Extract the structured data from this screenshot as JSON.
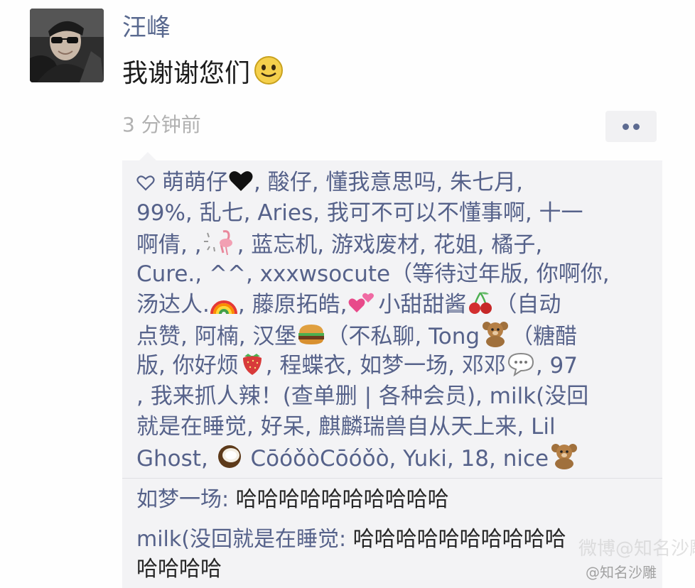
{
  "post": {
    "author": "汪峰",
    "text": "我谢谢您们",
    "timestamp": "3 分钟前",
    "emoji": "smile-emoji"
  },
  "likes": {
    "icon": "heart-outline-icon",
    "line1": {
      "a": "萌萌仔",
      "b": ", 酸仔, 懂我意思吗, 朱七月,"
    },
    "line2": "99%, 乱七, Aries, 我可不可以不懂事啊, 十一",
    "line3": {
      "a": "啊倩, ,",
      "b": ", 蓝忘机, 游戏废材, 花姐, 橘子,"
    },
    "line4": "Cure., ^^, xxxwsocute（等待过年版, 你啊你,",
    "line5": {
      "a": "汤达人.",
      "b": ", 藤原拓皓,",
      "c": "小甜甜酱",
      "d": "（自动"
    },
    "line6": {
      "a": "点赞, 阿楠, 汉堡",
      "b": "（不私聊, Tong",
      "c": "（糖醋"
    },
    "line7": {
      "a": "版, 你好烦",
      "b": ", 程蝶衣, 如梦一场, 邓邓",
      "c": ", 97"
    },
    "line8": ", 我来抓人辣！(查单删 | 各种会员), milk(没回",
    "line9": "就是在睡觉, 好呆, 麒麟瑞兽自从天上来, Lil",
    "line10": {
      "a": "Ghost,",
      "b": "CōóǒòCōóǒò, Yuki, 18, nice"
    }
  },
  "comments": [
    {
      "author": "如梦一场:",
      "text": " 哈哈哈哈哈哈哈哈哈哈"
    },
    {
      "author": "milk(没回就是在睡觉:",
      "text": " 哈哈哈哈哈哈哈哈哈哈",
      "text2": "哈哈哈哈"
    }
  ],
  "watermark": {
    "line1": "微博@知名沙雕",
    "line2": "@知名沙雕"
  },
  "colors": {
    "author": "#59698f",
    "link": "#56628a",
    "box": "#f3f3f5"
  }
}
